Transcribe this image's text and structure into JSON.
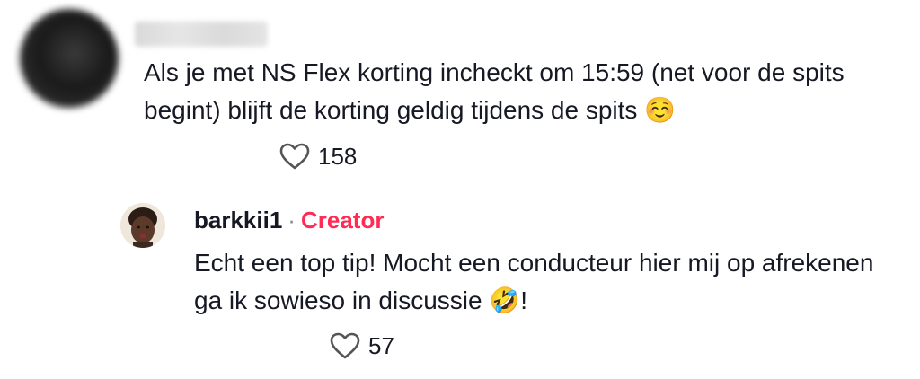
{
  "comment": {
    "text": "Als je met NS Flex korting incheckt om 15:59 (net voor de spits begint) blijft de korting geldig tijdens de spits ☺️",
    "likes": "158",
    "avatar_icon": "avatar-blurred",
    "like_icon": "heart-outline-icon"
  },
  "reply": {
    "username": "barkkii1",
    "separator": "·",
    "badge": "Creator",
    "badge_color": "#fe2c55",
    "text": "Echt een top tip! Mocht een conducteur hier mij op afrekenen ga ik sowieso in discussie 🤣!",
    "likes": "57",
    "like_icon": "heart-outline-icon"
  }
}
